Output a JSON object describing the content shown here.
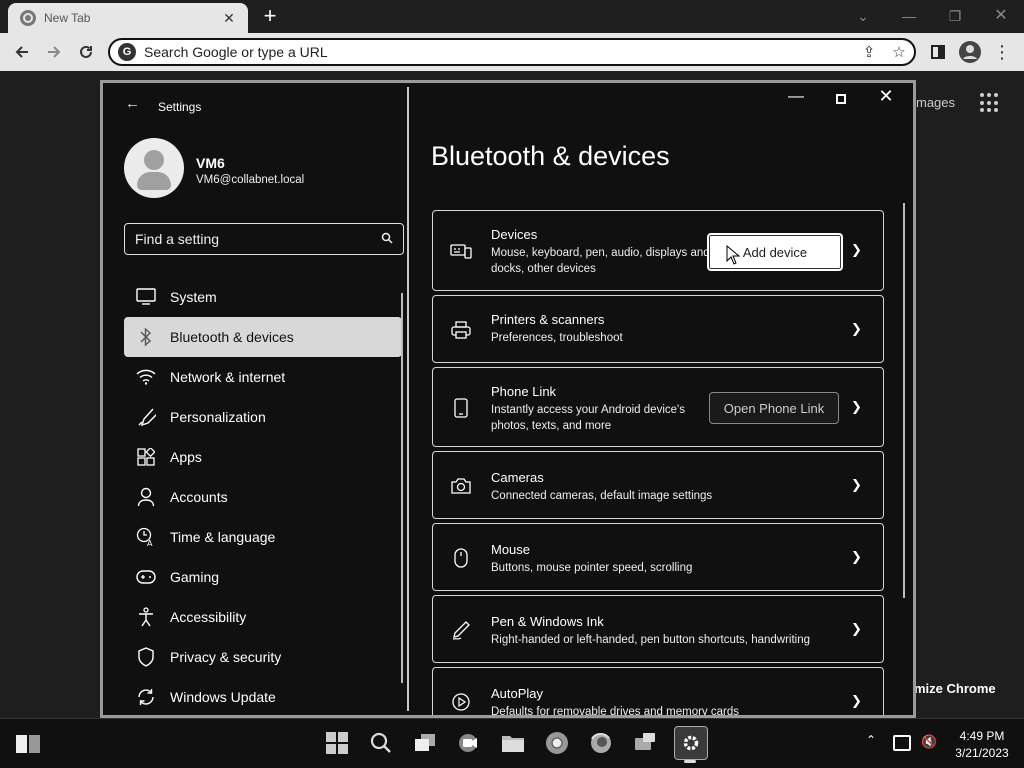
{
  "browser": {
    "tab_title": "New Tab",
    "tab_close": "✕",
    "new_tab": "+",
    "omnibox_placeholder": "Search Google or type a URL",
    "omnibox_g": "G",
    "background_images_text": "mages",
    "background_customize_text": "mize Chrome"
  },
  "settings": {
    "title": "Settings",
    "user": {
      "name": "VM6",
      "email": "VM6@collabnet.local"
    },
    "search_placeholder": "Find a setting",
    "nav": [
      {
        "label": "System",
        "icon": "monitor-icon",
        "selected": false
      },
      {
        "label": "Bluetooth & devices",
        "icon": "bluetooth-icon",
        "selected": true
      },
      {
        "label": "Network & internet",
        "icon": "wifi-icon",
        "selected": false
      },
      {
        "label": "Personalization",
        "icon": "brush-icon",
        "selected": false
      },
      {
        "label": "Apps",
        "icon": "apps-icon",
        "selected": false
      },
      {
        "label": "Accounts",
        "icon": "person-icon",
        "selected": false
      },
      {
        "label": "Time & language",
        "icon": "clock-language-icon",
        "selected": false
      },
      {
        "label": "Gaming",
        "icon": "gamepad-icon",
        "selected": false
      },
      {
        "label": "Accessibility",
        "icon": "accessibility-icon",
        "selected": false
      },
      {
        "label": "Privacy & security",
        "icon": "shield-icon",
        "selected": false
      },
      {
        "label": "Windows Update",
        "icon": "update-icon",
        "selected": false
      }
    ],
    "page_heading": "Bluetooth & devices",
    "cards": [
      {
        "title": "Devices",
        "description": "Mouse, keyboard, pen, audio, displays and docks, other devices",
        "button": "Add device",
        "icon": "devices-icon"
      },
      {
        "title": "Printers & scanners",
        "description": "Preferences, troubleshoot",
        "icon": "printer-icon"
      },
      {
        "title": "Phone Link",
        "description": "Instantly access your Android device's photos, texts, and more",
        "button": "Open Phone Link",
        "icon": "phone-icon"
      },
      {
        "title": "Cameras",
        "description": "Connected cameras, default image settings",
        "icon": "camera-icon"
      },
      {
        "title": "Mouse",
        "description": "Buttons, mouse pointer speed, scrolling",
        "icon": "mouse-icon"
      },
      {
        "title": "Pen & Windows Ink",
        "description": "Right-handed or left-handed, pen button shortcuts, handwriting",
        "icon": "pen-icon"
      },
      {
        "title": "AutoPlay",
        "description": "Defaults for removable drives and memory cards",
        "icon": "autoplay-icon"
      }
    ]
  },
  "taskbar": {
    "time": "4:49 PM",
    "date": "3/21/2023"
  }
}
